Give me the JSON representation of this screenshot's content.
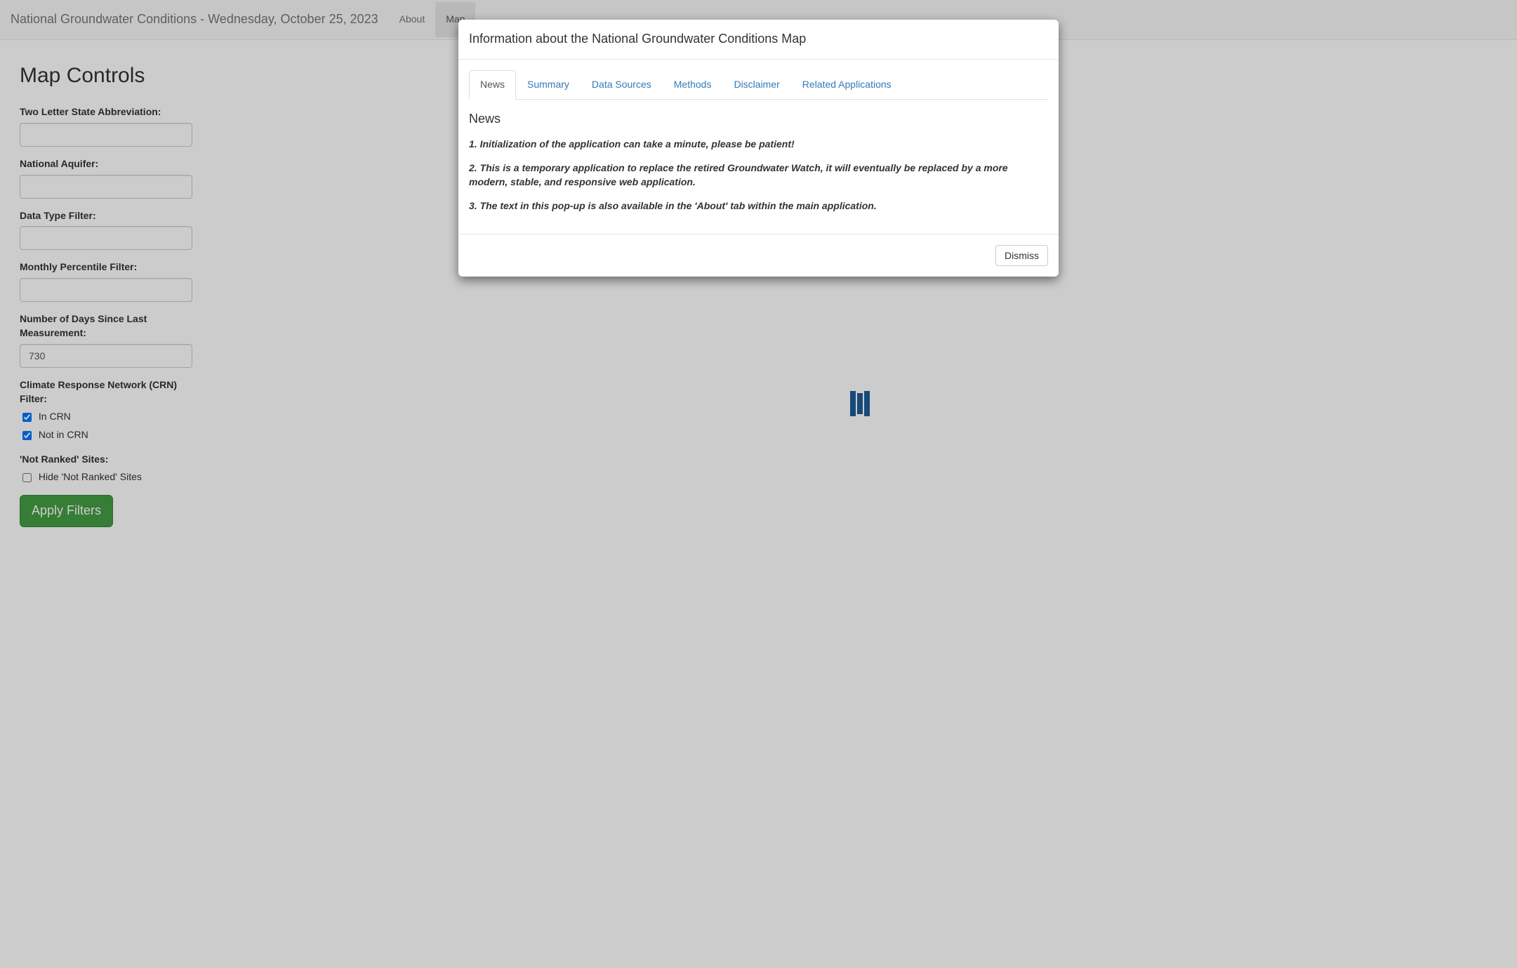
{
  "navbar": {
    "brand": "National Groundwater Conditions - Wednesday, October 25, 2023",
    "tabs": [
      {
        "label": "About",
        "active": false
      },
      {
        "label": "Map",
        "active": true
      }
    ]
  },
  "sidebar": {
    "title": "Map Controls",
    "state_label": "Two Letter State Abbreviation:",
    "state_value": "",
    "aquifer_label": "National Aquifer:",
    "aquifer_value": "",
    "data_type_label": "Data Type Filter:",
    "data_type_value": "",
    "percentile_label": "Monthly Percentile Filter:",
    "percentile_value": "",
    "days_label": "Number of Days Since Last Measurement:",
    "days_value": "730",
    "crn_label": "Climate Response Network (CRN) Filter:",
    "crn_in_label": "In CRN",
    "crn_in_checked": true,
    "crn_notin_label": "Not in CRN",
    "crn_notin_checked": true,
    "not_ranked_label": "'Not Ranked' Sites:",
    "hide_not_ranked_label": "Hide 'Not Ranked' Sites",
    "hide_not_ranked_checked": false,
    "apply_label": "Apply Filters"
  },
  "modal": {
    "title": "Information about the National Groundwater Conditions Map",
    "tabs": [
      "News",
      "Summary",
      "Data Sources",
      "Methods",
      "Disclaimer",
      "Related Applications"
    ],
    "news": {
      "heading": "News",
      "items": [
        "1. Initialization of the application can take a minute, please be patient!",
        "2. This is a temporary application to replace the retired Groundwater Watch, it will eventually be replaced by a more modern, stable, and responsive web application.",
        "3. The text in this pop-up is also available in the 'About' tab within the main application."
      ]
    },
    "dismiss": "Dismiss"
  }
}
